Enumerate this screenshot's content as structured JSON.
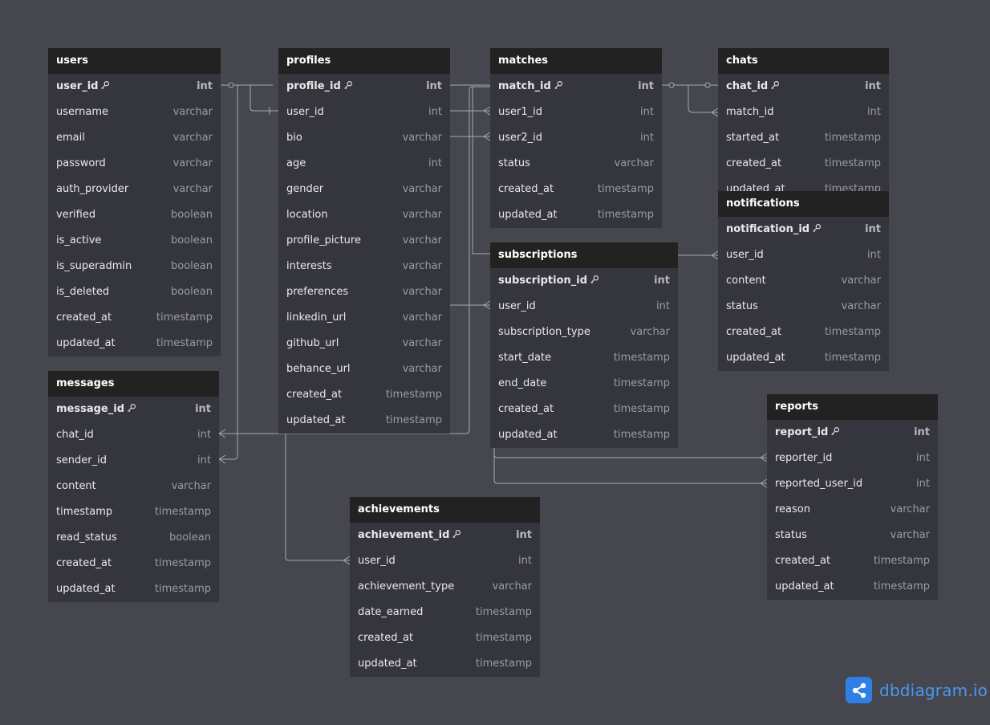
{
  "tables": [
    {
      "id": "users",
      "name": "users",
      "fields": [
        {
          "name": "user_id",
          "type": "int",
          "pk": true
        },
        {
          "name": "username",
          "type": "varchar"
        },
        {
          "name": "email",
          "type": "varchar"
        },
        {
          "name": "password",
          "type": "varchar"
        },
        {
          "name": "auth_provider",
          "type": "varchar"
        },
        {
          "name": "verified",
          "type": "boolean"
        },
        {
          "name": "is_active",
          "type": "boolean"
        },
        {
          "name": "is_superadmin",
          "type": "boolean"
        },
        {
          "name": "is_deleted",
          "type": "boolean"
        },
        {
          "name": "created_at",
          "type": "timestamp"
        },
        {
          "name": "updated_at",
          "type": "timestamp"
        }
      ]
    },
    {
      "id": "profiles",
      "name": "profiles",
      "fields": [
        {
          "name": "profile_id",
          "type": "int",
          "pk": true
        },
        {
          "name": "user_id",
          "type": "int"
        },
        {
          "name": "bio",
          "type": "varchar"
        },
        {
          "name": "age",
          "type": "int"
        },
        {
          "name": "gender",
          "type": "varchar"
        },
        {
          "name": "location",
          "type": "varchar"
        },
        {
          "name": "profile_picture",
          "type": "varchar"
        },
        {
          "name": "interests",
          "type": "varchar"
        },
        {
          "name": "preferences",
          "type": "varchar"
        },
        {
          "name": "linkedin_url",
          "type": "varchar"
        },
        {
          "name": "github_url",
          "type": "varchar"
        },
        {
          "name": "behance_url",
          "type": "varchar"
        },
        {
          "name": "created_at",
          "type": "timestamp"
        },
        {
          "name": "updated_at",
          "type": "timestamp"
        }
      ]
    },
    {
      "id": "matches",
      "name": "matches",
      "fields": [
        {
          "name": "match_id",
          "type": "int",
          "pk": true
        },
        {
          "name": "user1_id",
          "type": "int"
        },
        {
          "name": "user2_id",
          "type": "int"
        },
        {
          "name": "status",
          "type": "varchar"
        },
        {
          "name": "created_at",
          "type": "timestamp"
        },
        {
          "name": "updated_at",
          "type": "timestamp"
        }
      ]
    },
    {
      "id": "chats",
      "name": "chats",
      "fields": [
        {
          "name": "chat_id",
          "type": "int",
          "pk": true
        },
        {
          "name": "match_id",
          "type": "int"
        },
        {
          "name": "started_at",
          "type": "timestamp"
        },
        {
          "name": "created_at",
          "type": "timestamp"
        },
        {
          "name": "updated_at",
          "type": "timestamp"
        }
      ]
    },
    {
      "id": "notifications",
      "name": "notifications",
      "fields": [
        {
          "name": "notification_id",
          "type": "int",
          "pk": true
        },
        {
          "name": "user_id",
          "type": "int"
        },
        {
          "name": "content",
          "type": "varchar"
        },
        {
          "name": "status",
          "type": "varchar"
        },
        {
          "name": "created_at",
          "type": "timestamp"
        },
        {
          "name": "updated_at",
          "type": "timestamp"
        }
      ]
    },
    {
      "id": "subscriptions",
      "name": "subscriptions",
      "fields": [
        {
          "name": "subscription_id",
          "type": "int",
          "pk": true
        },
        {
          "name": "user_id",
          "type": "int"
        },
        {
          "name": "subscription_type",
          "type": "varchar"
        },
        {
          "name": "start_date",
          "type": "timestamp"
        },
        {
          "name": "end_date",
          "type": "timestamp"
        },
        {
          "name": "created_at",
          "type": "timestamp"
        },
        {
          "name": "updated_at",
          "type": "timestamp"
        }
      ]
    },
    {
      "id": "messages",
      "name": "messages",
      "fields": [
        {
          "name": "message_id",
          "type": "int",
          "pk": true
        },
        {
          "name": "chat_id",
          "type": "int"
        },
        {
          "name": "sender_id",
          "type": "int"
        },
        {
          "name": "content",
          "type": "varchar"
        },
        {
          "name": "timestamp",
          "type": "timestamp"
        },
        {
          "name": "read_status",
          "type": "boolean"
        },
        {
          "name": "created_at",
          "type": "timestamp"
        },
        {
          "name": "updated_at",
          "type": "timestamp"
        }
      ]
    },
    {
      "id": "reports",
      "name": "reports",
      "fields": [
        {
          "name": "report_id",
          "type": "int",
          "pk": true
        },
        {
          "name": "reporter_id",
          "type": "int"
        },
        {
          "name": "reported_user_id",
          "type": "int"
        },
        {
          "name": "reason",
          "type": "varchar"
        },
        {
          "name": "status",
          "type": "varchar"
        },
        {
          "name": "created_at",
          "type": "timestamp"
        },
        {
          "name": "updated_at",
          "type": "timestamp"
        }
      ]
    },
    {
      "id": "achievements",
      "name": "achievements",
      "fields": [
        {
          "name": "achievement_id",
          "type": "int",
          "pk": true
        },
        {
          "name": "user_id",
          "type": "int"
        },
        {
          "name": "achievement_type",
          "type": "varchar"
        },
        {
          "name": "date_earned",
          "type": "timestamp"
        },
        {
          "name": "created_at",
          "type": "timestamp"
        },
        {
          "name": "updated_at",
          "type": "timestamp"
        }
      ]
    }
  ],
  "relationships": [
    {
      "from": "users.user_id",
      "to": "profiles.user_id",
      "type": "one-to-one"
    },
    {
      "from": "users.user_id",
      "to": "matches.user1_id",
      "type": "one-to-many"
    },
    {
      "from": "users.user_id",
      "to": "matches.user2_id",
      "type": "one-to-many"
    },
    {
      "from": "users.user_id",
      "to": "subscriptions.user_id",
      "type": "one-to-many"
    },
    {
      "from": "users.user_id",
      "to": "notifications.user_id",
      "type": "one-to-many"
    },
    {
      "from": "users.user_id",
      "to": "messages.sender_id",
      "type": "one-to-many"
    },
    {
      "from": "users.user_id",
      "to": "achievements.user_id",
      "type": "one-to-many"
    },
    {
      "from": "users.user_id",
      "to": "reports.reporter_id",
      "type": "one-to-many"
    },
    {
      "from": "users.user_id",
      "to": "reports.reported_user_id",
      "type": "one-to-many"
    },
    {
      "from": "matches.match_id",
      "to": "chats.match_id",
      "type": "one-to-many"
    },
    {
      "from": "chats.chat_id",
      "to": "messages.chat_id",
      "type": "one-to-many"
    }
  ],
  "brand": {
    "name": "dbdiagram.io",
    "icon": "share-icon"
  },
  "colors": {
    "background": "#45464e",
    "header": "#222222",
    "table_body": "#35363d",
    "connector": "#a9aab0",
    "brand": "#2f7fe6"
  }
}
